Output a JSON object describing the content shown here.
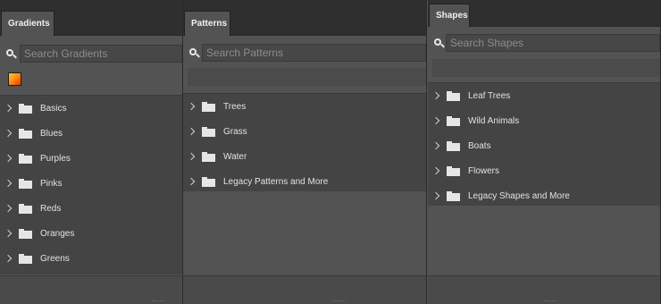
{
  "gradients": {
    "tab_label": "Gradients",
    "search_placeholder": "Search Gradients",
    "items": [
      {
        "label": "Basics"
      },
      {
        "label": "Blues"
      },
      {
        "label": "Purples"
      },
      {
        "label": "Pinks"
      },
      {
        "label": "Reds"
      },
      {
        "label": "Oranges"
      },
      {
        "label": "Greens"
      }
    ]
  },
  "patterns": {
    "tab_label": "Patterns",
    "search_placeholder": "Search Patterns",
    "items": [
      {
        "label": "Trees"
      },
      {
        "label": "Grass"
      },
      {
        "label": "Water"
      },
      {
        "label": "Legacy Patterns and More"
      }
    ]
  },
  "shapes": {
    "tab_label": "Shapes",
    "search_placeholder": "Search Shapes",
    "items": [
      {
        "label": "Leaf Trees"
      },
      {
        "label": "Wild Animals"
      },
      {
        "label": "Boats"
      },
      {
        "label": "Flowers"
      },
      {
        "label": "Legacy Shapes and More"
      }
    ]
  },
  "icons": {
    "search": "search-icon",
    "folder": "folder-icon",
    "expand": "chevron-right-icon"
  },
  "colors": {
    "panel_bg": "#535353",
    "list_bg": "#444444",
    "tabbar_bg": "#2f2f2f",
    "text": "#e2e2e2",
    "placeholder": "#8c8c8c"
  }
}
